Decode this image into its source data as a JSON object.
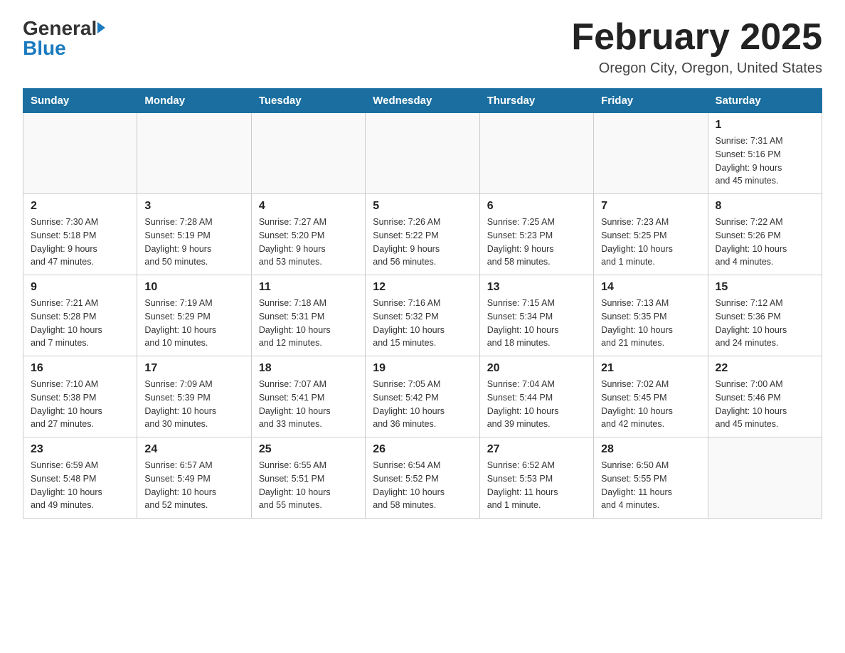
{
  "header": {
    "logo_general": "General",
    "logo_blue": "Blue",
    "month_title": "February 2025",
    "location": "Oregon City, Oregon, United States"
  },
  "days_of_week": [
    "Sunday",
    "Monday",
    "Tuesday",
    "Wednesday",
    "Thursday",
    "Friday",
    "Saturday"
  ],
  "weeks": [
    [
      {
        "day": "",
        "info": ""
      },
      {
        "day": "",
        "info": ""
      },
      {
        "day": "",
        "info": ""
      },
      {
        "day": "",
        "info": ""
      },
      {
        "day": "",
        "info": ""
      },
      {
        "day": "",
        "info": ""
      },
      {
        "day": "1",
        "info": "Sunrise: 7:31 AM\nSunset: 5:16 PM\nDaylight: 9 hours\nand 45 minutes."
      }
    ],
    [
      {
        "day": "2",
        "info": "Sunrise: 7:30 AM\nSunset: 5:18 PM\nDaylight: 9 hours\nand 47 minutes."
      },
      {
        "day": "3",
        "info": "Sunrise: 7:28 AM\nSunset: 5:19 PM\nDaylight: 9 hours\nand 50 minutes."
      },
      {
        "day": "4",
        "info": "Sunrise: 7:27 AM\nSunset: 5:20 PM\nDaylight: 9 hours\nand 53 minutes."
      },
      {
        "day": "5",
        "info": "Sunrise: 7:26 AM\nSunset: 5:22 PM\nDaylight: 9 hours\nand 56 minutes."
      },
      {
        "day": "6",
        "info": "Sunrise: 7:25 AM\nSunset: 5:23 PM\nDaylight: 9 hours\nand 58 minutes."
      },
      {
        "day": "7",
        "info": "Sunrise: 7:23 AM\nSunset: 5:25 PM\nDaylight: 10 hours\nand 1 minute."
      },
      {
        "day": "8",
        "info": "Sunrise: 7:22 AM\nSunset: 5:26 PM\nDaylight: 10 hours\nand 4 minutes."
      }
    ],
    [
      {
        "day": "9",
        "info": "Sunrise: 7:21 AM\nSunset: 5:28 PM\nDaylight: 10 hours\nand 7 minutes."
      },
      {
        "day": "10",
        "info": "Sunrise: 7:19 AM\nSunset: 5:29 PM\nDaylight: 10 hours\nand 10 minutes."
      },
      {
        "day": "11",
        "info": "Sunrise: 7:18 AM\nSunset: 5:31 PM\nDaylight: 10 hours\nand 12 minutes."
      },
      {
        "day": "12",
        "info": "Sunrise: 7:16 AM\nSunset: 5:32 PM\nDaylight: 10 hours\nand 15 minutes."
      },
      {
        "day": "13",
        "info": "Sunrise: 7:15 AM\nSunset: 5:34 PM\nDaylight: 10 hours\nand 18 minutes."
      },
      {
        "day": "14",
        "info": "Sunrise: 7:13 AM\nSunset: 5:35 PM\nDaylight: 10 hours\nand 21 minutes."
      },
      {
        "day": "15",
        "info": "Sunrise: 7:12 AM\nSunset: 5:36 PM\nDaylight: 10 hours\nand 24 minutes."
      }
    ],
    [
      {
        "day": "16",
        "info": "Sunrise: 7:10 AM\nSunset: 5:38 PM\nDaylight: 10 hours\nand 27 minutes."
      },
      {
        "day": "17",
        "info": "Sunrise: 7:09 AM\nSunset: 5:39 PM\nDaylight: 10 hours\nand 30 minutes."
      },
      {
        "day": "18",
        "info": "Sunrise: 7:07 AM\nSunset: 5:41 PM\nDaylight: 10 hours\nand 33 minutes."
      },
      {
        "day": "19",
        "info": "Sunrise: 7:05 AM\nSunset: 5:42 PM\nDaylight: 10 hours\nand 36 minutes."
      },
      {
        "day": "20",
        "info": "Sunrise: 7:04 AM\nSunset: 5:44 PM\nDaylight: 10 hours\nand 39 minutes."
      },
      {
        "day": "21",
        "info": "Sunrise: 7:02 AM\nSunset: 5:45 PM\nDaylight: 10 hours\nand 42 minutes."
      },
      {
        "day": "22",
        "info": "Sunrise: 7:00 AM\nSunset: 5:46 PM\nDaylight: 10 hours\nand 45 minutes."
      }
    ],
    [
      {
        "day": "23",
        "info": "Sunrise: 6:59 AM\nSunset: 5:48 PM\nDaylight: 10 hours\nand 49 minutes."
      },
      {
        "day": "24",
        "info": "Sunrise: 6:57 AM\nSunset: 5:49 PM\nDaylight: 10 hours\nand 52 minutes."
      },
      {
        "day": "25",
        "info": "Sunrise: 6:55 AM\nSunset: 5:51 PM\nDaylight: 10 hours\nand 55 minutes."
      },
      {
        "day": "26",
        "info": "Sunrise: 6:54 AM\nSunset: 5:52 PM\nDaylight: 10 hours\nand 58 minutes."
      },
      {
        "day": "27",
        "info": "Sunrise: 6:52 AM\nSunset: 5:53 PM\nDaylight: 11 hours\nand 1 minute."
      },
      {
        "day": "28",
        "info": "Sunrise: 6:50 AM\nSunset: 5:55 PM\nDaylight: 11 hours\nand 4 minutes."
      },
      {
        "day": "",
        "info": ""
      }
    ]
  ]
}
